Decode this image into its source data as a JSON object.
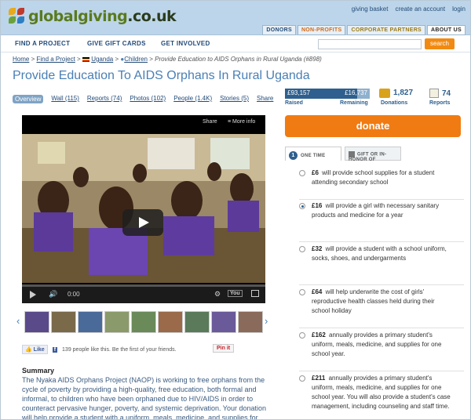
{
  "header": {
    "logo_main": "globalgiving",
    "logo_suffix": ".co.uk",
    "toplinks": [
      "giving basket",
      "create an account",
      "login"
    ],
    "maintabs": [
      "DONORS",
      "NON-PROFITS",
      "CORPORATE PARTNERS",
      "ABOUT US"
    ]
  },
  "nav": {
    "items": [
      "FIND A PROJECT",
      "GIVE GIFT CARDS",
      "GET INVOLVED"
    ],
    "search_label": "search"
  },
  "breadcrumb": {
    "home": "Home",
    "find": "Find a Project",
    "country": "Uganda",
    "theme": "Children",
    "current": "Provide Education to AIDS Orphans in Rural Uganda (#898)"
  },
  "page_title": "Provide Education To AIDS Orphans In Rural Uganda",
  "tabs": [
    "Overview",
    "Wall (115)",
    "Reports (74)",
    "Photos (102)",
    "People (1.4K)",
    "Stories (5)",
    "Share"
  ],
  "video": {
    "share": "Share",
    "more_info": "More info",
    "time": "0:00"
  },
  "social": {
    "like": "Like",
    "fb_text": "139 people like this. Be the first of your friends.",
    "pin": "Pin it"
  },
  "summary": {
    "heading": "Summary",
    "text": "The Nyaka AIDS Orphans Project (NAOP) is working to free orphans from the cycle of poverty by providing a high-quality, free education, both formal and informal, to children who have been orphaned due to HIV/AIDS in order to counteract pervasive hunger, poverty, and systemic deprivation. Your donation will help provide a student with a uniform, meals, medicine, and supplies for one"
  },
  "stats": {
    "raised": "£93,157",
    "remaining": "£16,737",
    "raised_label": "Raised",
    "remaining_label": "Remaining",
    "raised_fraction": 0.848,
    "donations": "1,827",
    "donations_label": "Donations",
    "reports": "74",
    "reports_label": "Reports"
  },
  "donate_label": "donate",
  "gift_tabs": {
    "one_time_num": "1",
    "one_time": "ONE TIME",
    "gift": "GIFT OR IN-HONOR OF"
  },
  "options": [
    {
      "amount": "£6",
      "text": "will provide school supplies for a student attending secondary school",
      "selected": false
    },
    {
      "amount": "£16",
      "text": "will provide a girl with necessary sanitary products and medicine for a year",
      "selected": true
    },
    {
      "amount": "£32",
      "text": "will provide a student with a school uniform, socks, shoes, and undergarments",
      "selected": false
    },
    {
      "amount": "£64",
      "text": "will help underwrite the cost of girls' reproductive health classes held during their school holiday",
      "selected": false
    },
    {
      "amount": "£162",
      "text": "annually provides a primary student's uniform, meals, medicine, and supplies for one school year.",
      "selected": false
    },
    {
      "amount": "£211",
      "text": "annually provides a primary student's uniform, meals, medicine, and supplies for one school year. You will also provide a student's case management, including counseling and staff time.",
      "selected": false
    }
  ],
  "colors": {
    "accent": "#f07b12",
    "link": "#234b78",
    "title": "#4a7fb5",
    "header_bg": "#bcd5ea"
  }
}
